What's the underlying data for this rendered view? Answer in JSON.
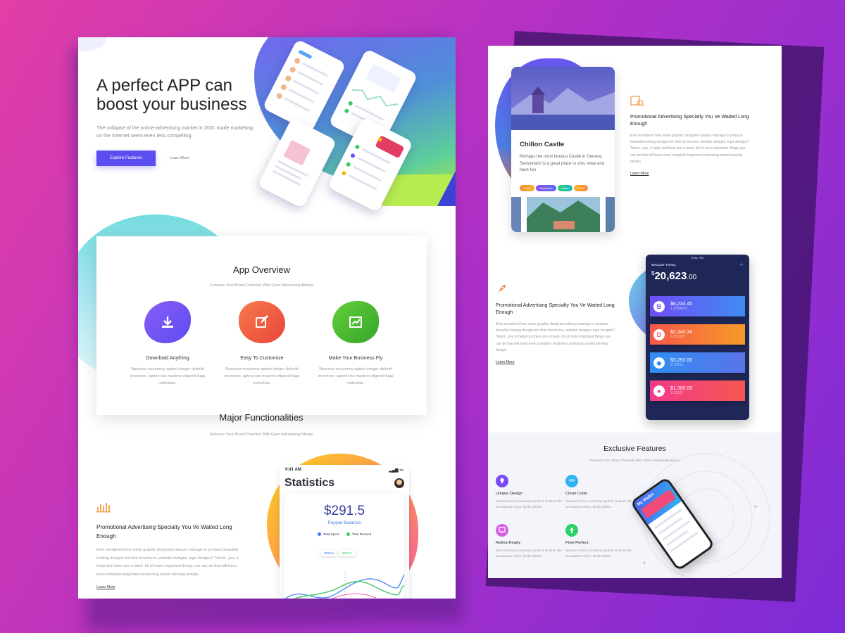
{
  "hero": {
    "title_line1": "A perfect APP can",
    "title_line2": "boost your business",
    "subtitle": "The collapse of the online-advertising market in 2001 made marketing on the Internet seem even less compelling.",
    "primary_button": "Explore Features",
    "secondary_link": "Learn More"
  },
  "overview": {
    "title": "App Overview",
    "subtitle": "Enhance Your Brand Potential With Giant Advertising Blimps",
    "features": [
      {
        "label": "Download Anything",
        "text": "Nascetur nonummy aptent integer deleniti inventore, aptent iste maxime eligendi fuga molestiae.",
        "icon": "download-icon",
        "color": "#6c4cf6"
      },
      {
        "label": "Easy To Customize",
        "text": "Nascetur nonummy aptent integer deleniti inventore, aptent iste maxime eligendi fuga molestiae.",
        "icon": "edit-icon",
        "color": "#f0573f"
      },
      {
        "label": "Make Your Business Fly",
        "text": "Nascetur nonummy aptent integer deleniti inventore, aptent iste maxime eligendi fuga molestiae.",
        "icon": "trending-up-icon",
        "color": "#49b82f"
      }
    ]
  },
  "major": {
    "title": "Major Functionalities",
    "subtitle": "Enhance Your Brand Potential With Giant Advertising Blimps"
  },
  "promo_left": {
    "title": "Promotional Advertising Specialty You Ve Waited Long Enough",
    "text": "Ever wondered how some graphic designers always manage to produce beautiful looking designs for their brochures, website designs, logo designs? Talent...yes, it helps but there are a hand- ful of more important things you can do that will have even complete beginners producing award winning design.",
    "link": "Learn More"
  },
  "statistics": {
    "time": "9:41 AM",
    "title": "Statistics",
    "amount": "$291.5",
    "balance_label": "Paypal Balance",
    "legend_spent": "Total Spent",
    "legend_received": "Total Recived",
    "tag1": "$256.5",
    "tag2": "$300.0"
  },
  "castle": {
    "name": "Chillon Castle",
    "description": "Perhaps the most famous Castle in Geneva, Switzerland is a great place to visit, relax and have fun",
    "tags": [
      {
        "label": "Castle",
        "color": "#f58a3c"
      },
      {
        "label": "Mountains",
        "color": "#8a4ff0"
      },
      {
        "label": "Lakes",
        "color": "#2ecf7a"
      },
      {
        "label": "Trees",
        "color": "#f6b21b"
      }
    ]
  },
  "promo_right1": {
    "title": "Promotional Advertising Specialty You Ve Waited Long Enough",
    "text": "Ever wondered how some graphic designers always manage to produce beautiful looking designs for their brochures, website designs, logo designs? Talent...yes, it helps but there are a hand- ful of more important things you can do that will have even complete beginners producing award winning design.",
    "link": "Learn More"
  },
  "promo_right2": {
    "title": "Promotional Advertising Specialty You Ve Waited Long Enough",
    "text": "Ever wondered how some graphic designers always manage to produce beautiful looking designs for their brochures, website designs, logo designs? Talent...yes, it helps but there are a hand- ful of more important things you can do that will have even complete beginners producing award winning design.",
    "link": "Learn More"
  },
  "wallet": {
    "time": "9:41 AM",
    "label": "WALLET TOTAL",
    "currency": "$",
    "total_main": "20,623",
    "total_cents": ".00",
    "coins": [
      {
        "amount": "$6,234.40",
        "sub": "1.2584063",
        "color1": "#6f4ef6",
        "color2": "#3f8cf0"
      },
      {
        "amount": "$2,340.34",
        "sub": "6.252335",
        "color1": "#f7574a",
        "color2": "#f59a28"
      },
      {
        "amount": "$3,293.00",
        "sub": "8.70011",
        "color1": "#2f8ef2",
        "color2": "#5a74e8"
      },
      {
        "amount": "$1,300.00",
        "sub": "2.32225",
        "color1": "#f33a8a",
        "color2": "#f5574f"
      }
    ]
  },
  "exclusive": {
    "title": "Exclusive Features",
    "subtitle": "Enhance Your Brand Potential With Giant Advertising Blimps",
    "items": [
      {
        "title": "Unique Design",
        "text": "Nesciunt rerum accusanti quod et incidunt iste accusamus nemo, facilis debitis.",
        "icon": "diamond-icon",
        "color": "#7b4af2"
      },
      {
        "title": "Clean Code",
        "text": "Nesciunt rerum accusanti quod et incidunt iste accusamus nemo, facilis debitis.",
        "icon": "code-icon",
        "color": "#2fb4f0"
      },
      {
        "title": "Retina Ready",
        "text": "Nesciunt rerum accusanti quod et incidunt iste accusamus nemo, facilis debitis.",
        "icon": "monitor-icon",
        "color": "#d860e8"
      },
      {
        "title": "Pixel Perfect",
        "text": "Nesciunt rerum accusanti quod et incidunt iste accusamus nemo, facilis debitis.",
        "icon": "pixel-icon",
        "color": "#2ed06a"
      }
    ],
    "phone_title": "My Wallet"
  }
}
